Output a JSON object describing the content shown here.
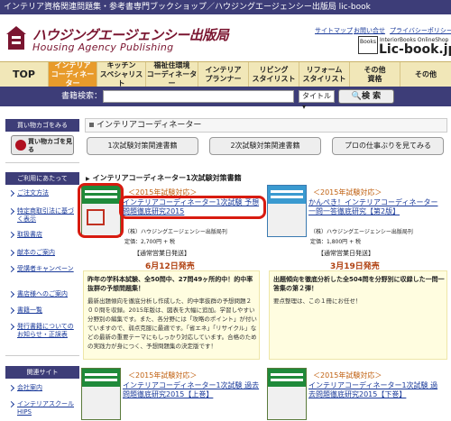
{
  "topbar": {
    "text": "インテリア資格関連問題集・参考書専門ブックショップ／ハウジングエージェンシー出版局 lic-book"
  },
  "header": {
    "logo_jp": "ハウジングエージェンシー出版局",
    "logo_en": "Housing Agency Publishing",
    "util_links": [
      "サイトマップ",
      "お問い合せ",
      "プライバシーポリシー"
    ],
    "lic_box": "Books",
    "lic_small": "InteriorBooks OnlineShop",
    "lic_logo": "Lic-book.jp"
  },
  "nav": [
    "TOP",
    "インテリア\nコーディネーター",
    "キッチン\nスペシャリスト",
    "福祉住環境\nコーディネーター",
    "インテリア\nプランナー",
    "リビング\nスタイリスト",
    "リフォーム\nスタイリスト",
    "その他\n資格",
    "その他"
  ],
  "search": {
    "label": "書籍検索：",
    "select": "タイトル",
    "button": "検 索"
  },
  "sidebar": {
    "cart_title": "買い物カゴをみる",
    "cart_button": "買い物カゴを見る",
    "guide_title": "ご利用にあたって",
    "guide_links": [
      "ご注文方法",
      "特定商取引法に基づく表示",
      "取扱書店",
      "献本のご案内",
      "受講者キャンペーン",
      "書店様へのご案内",
      "書籍一覧",
      "発行書籍についてのお知らせ・正誤表"
    ],
    "related_title": "関連サイト",
    "related_links": [
      "会社案内",
      "インテリアスクールHIPS"
    ]
  },
  "main": {
    "breadcrumb": "インテリアコーディネーター",
    "tabs": [
      "1次試験対策関連書籍",
      "2次試験対策関連書籍",
      "プロの仕事ぶりを見てみる"
    ],
    "section_title": "インテリアコーディネーター1次試験対策書籍",
    "books": [
      {
        "tag": "＜2015年試験対応＞",
        "title": "インテリアコーディネーター1次試験 予想問題徹底研究2015",
        "publisher": "（株）ハウジングエージェンシー出版局刊",
        "price": "定価：2,700円 + 税",
        "badge": "【通常営業日発送】",
        "release": "6月12日発売",
        "desc_title": "昨年の学科本試験、全50問中、27問49ヶ所的中！的中率抜群の予想問題集！",
        "desc_body": "最新出題傾向を徹底分析し作成した、的中率抜群の予想問題２００問を収録。2015年版は、図表を大幅に追加。学習しやすい分野別の編集です。また、各分野には「攻略のポイント」が付いていますので、弱点克服に最適です。「省エネ」「リサイクル」などの最新の重要テーマにもしっかり対応しています。合格のための実践力が身につく、予想問題集の決定版です！"
      },
      {
        "tag": "＜2015年試験対応＞",
        "title": "かんぺき！インテリアコーディネーター 一問一答徹底研究【第2版】",
        "publisher": "（株）ハウジングエージェンシー出版局刊",
        "price": "定価：1,800円 + 税",
        "badge": "【通常営業日発送】",
        "release": "3月19日発売",
        "desc_title": "出題傾向を徹底分析した全504問を分野別に収録した一問一答集の第２弾！",
        "desc_body": "要点整理は、この１冊にお任せ！"
      },
      {
        "tag": "＜2015年試験対応＞",
        "title": "インテリアコーディネーター1次試験 過去問題徹底研究2015【上巻】"
      },
      {
        "tag": "＜2015年試験対応＞",
        "title": "インテリアコーディネーター1次試験 過去問題徹底研究2015【下巻】"
      }
    ]
  },
  "colors": {
    "nav_bar": "#3d3d78",
    "nav_active": "#e89b2b",
    "nav_bg": "#f1e7b8",
    "highlight": "#d81b10",
    "book_green": "#1f8a3a"
  }
}
